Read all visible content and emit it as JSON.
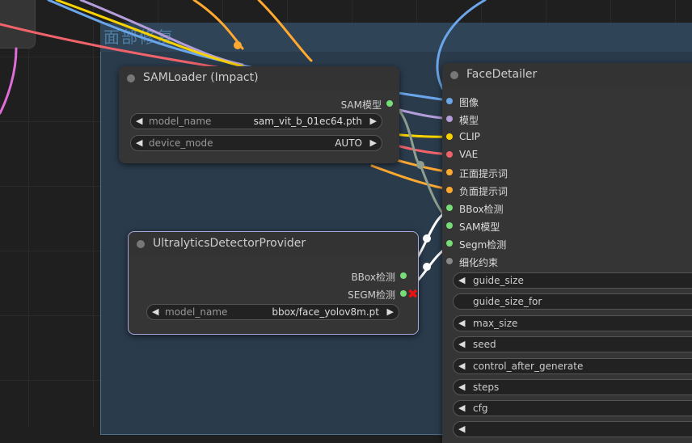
{
  "group": {
    "title": "面部修复"
  },
  "sam_loader": {
    "title": "SAMLoader (Impact)",
    "output": "SAM模型",
    "widgets": [
      {
        "name": "model_name",
        "value": "sam_vit_b_01ec64.pth"
      },
      {
        "name": "device_mode",
        "value": "AUTO"
      }
    ]
  },
  "ultralytics": {
    "title": "UltralyticsDetectorProvider",
    "outputs": [
      "BBox检测",
      "SEGM检测"
    ],
    "widgets": [
      {
        "name": "model_name",
        "value": "bbox/face_yolov8m.pt"
      }
    ]
  },
  "face_detailer": {
    "title": "FaceDetailer",
    "inputs": [
      "图像",
      "模型",
      "CLIP",
      "VAE",
      "正面提示词",
      "负面提示词",
      "BBox检测",
      "SAM模型",
      "Segm检测",
      "细化约束"
    ],
    "widgets": [
      "guide_size",
      "guide_size_for",
      "max_size",
      "seed",
      "control_after_generate",
      "steps",
      "cfg"
    ]
  },
  "colors": {
    "image": "#6ba6ea",
    "model": "#b39ddb",
    "clip": "#f7d100",
    "vae": "#f0636b",
    "conditioning": "#ffa931",
    "detector": "#77dd77",
    "constraint": "#888888"
  }
}
